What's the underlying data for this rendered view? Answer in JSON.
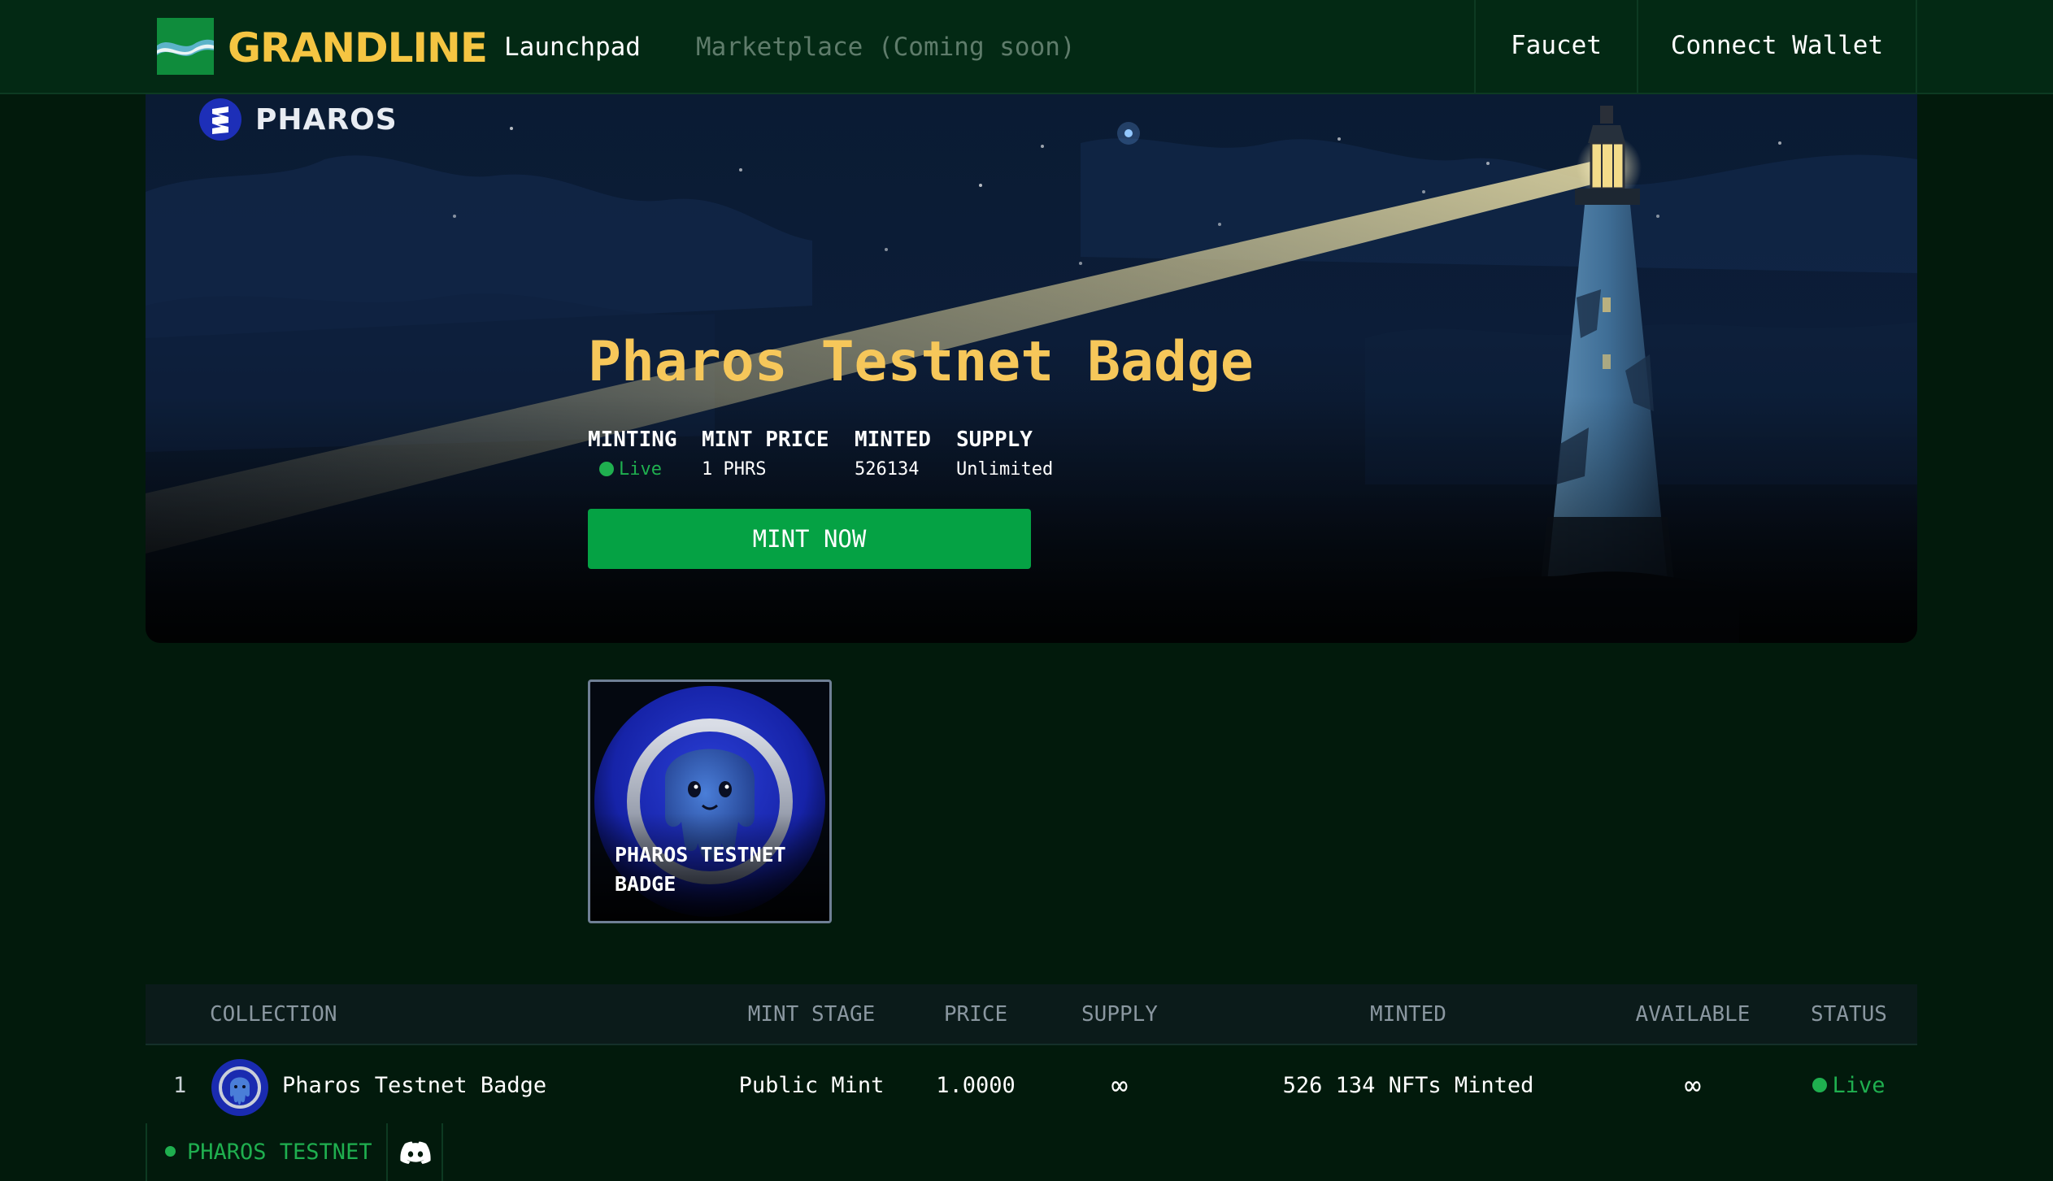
{
  "brand": {
    "name": "GRANDLINE",
    "logo_icon": "grandline-wave-logo-icon"
  },
  "nav": {
    "launchpad": "Launchpad",
    "marketplace": "Marketplace (Coming soon)",
    "faucet": "Faucet",
    "connect_wallet": "Connect Wallet"
  },
  "hero": {
    "partner_name": "PHAROS",
    "partner_icon": "pharos-logo-icon",
    "title": "Pharos Testnet Badge",
    "stats": {
      "minting_label": "MINTING",
      "minting_value": "Live",
      "price_label": "MINT PRICE",
      "price_value": "1 PHRS",
      "minted_label": "MINTED",
      "minted_value": "526134",
      "supply_label": "SUPPLY",
      "supply_value": "Unlimited"
    },
    "mint_button": "MINT NOW"
  },
  "badge_card": {
    "caption": "PHAROS TESTNET BADGE",
    "image_icon": "octopus-badge-icon"
  },
  "table": {
    "headers": {
      "collection": "COLLECTION",
      "stage": "MINT STAGE",
      "price": "PRICE",
      "supply": "SUPPLY",
      "minted": "MINTED",
      "available": "AVAILABLE",
      "status": "STATUS"
    },
    "rows": [
      {
        "rank": "1",
        "name": "Pharos Testnet Badge",
        "stage": "Public Mint",
        "price": "1.0000",
        "supply": "∞",
        "minted": "526 134 NFTs Minted",
        "available": "∞",
        "status": "Live"
      }
    ]
  },
  "footer": {
    "network": "PHAROS TESTNET",
    "discord_icon": "discord-icon"
  },
  "colors": {
    "accent_green": "#05a244",
    "live_green": "#1faf4f",
    "brand_yellow": "#f5c542",
    "title_yellow": "#f6c75a",
    "background": "#021a0c",
    "nav_background": "#032914"
  }
}
